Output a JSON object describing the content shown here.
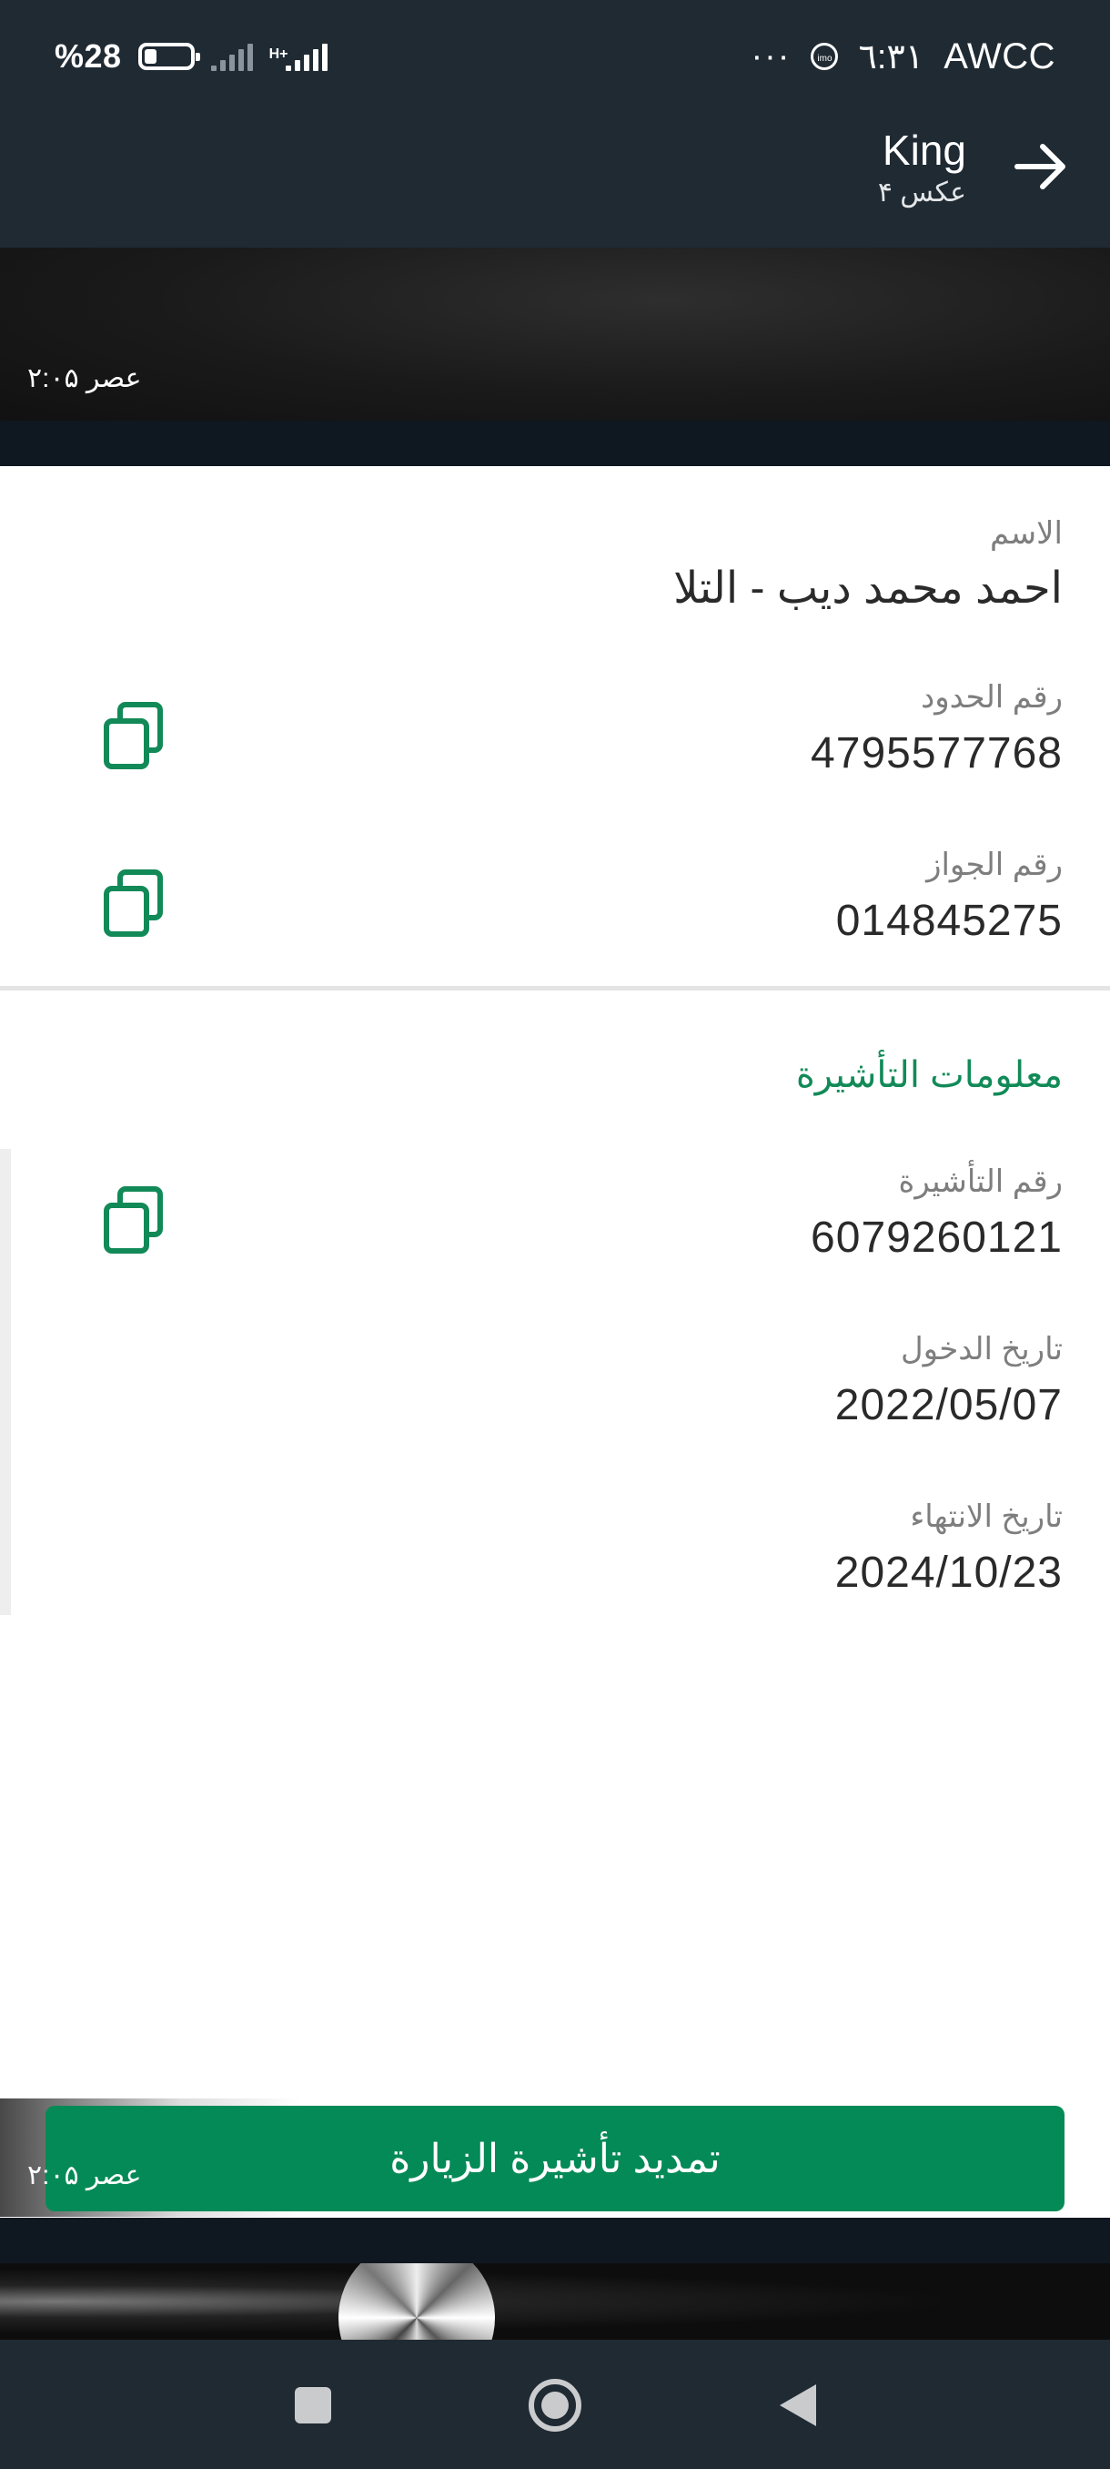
{
  "status_bar": {
    "battery_percent": "%28",
    "battery_level": 0.28,
    "network_type": "H+",
    "carrier": "AWCC",
    "time": "٦:٣١",
    "messenger_icon_text": "imo",
    "more": "···"
  },
  "header": {
    "title": "King",
    "subtitle": "۴ عکس"
  },
  "photo": {
    "timestamp_top": "۲:۰۵ عصر",
    "timestamp_bottom": "۲:۰۵ عصر"
  },
  "personal": {
    "name_label": "الاسم",
    "name_value": "احمد محمد ديب - التلا",
    "border_label": "رقم الحدود",
    "border_value": "4795577768",
    "passport_label": "رقم الجواز",
    "passport_value": "014845275"
  },
  "visa": {
    "section_title": "معلومات التأشيرة",
    "visa_number_label": "رقم التأشيرة",
    "visa_number_value": "6079260121",
    "entry_date_label": "تاريخ الدخول",
    "entry_date_value": "2022/05/07",
    "expiry_date_label": "تاريخ الانتهاء",
    "expiry_date_value": "2024/10/23"
  },
  "actions": {
    "extend_visa_label": "تمديد تأشيرة الزيارة"
  },
  "colors": {
    "header_bg": "#1f2a33",
    "accent_green": "#048a57",
    "section_green": "#128a58"
  }
}
